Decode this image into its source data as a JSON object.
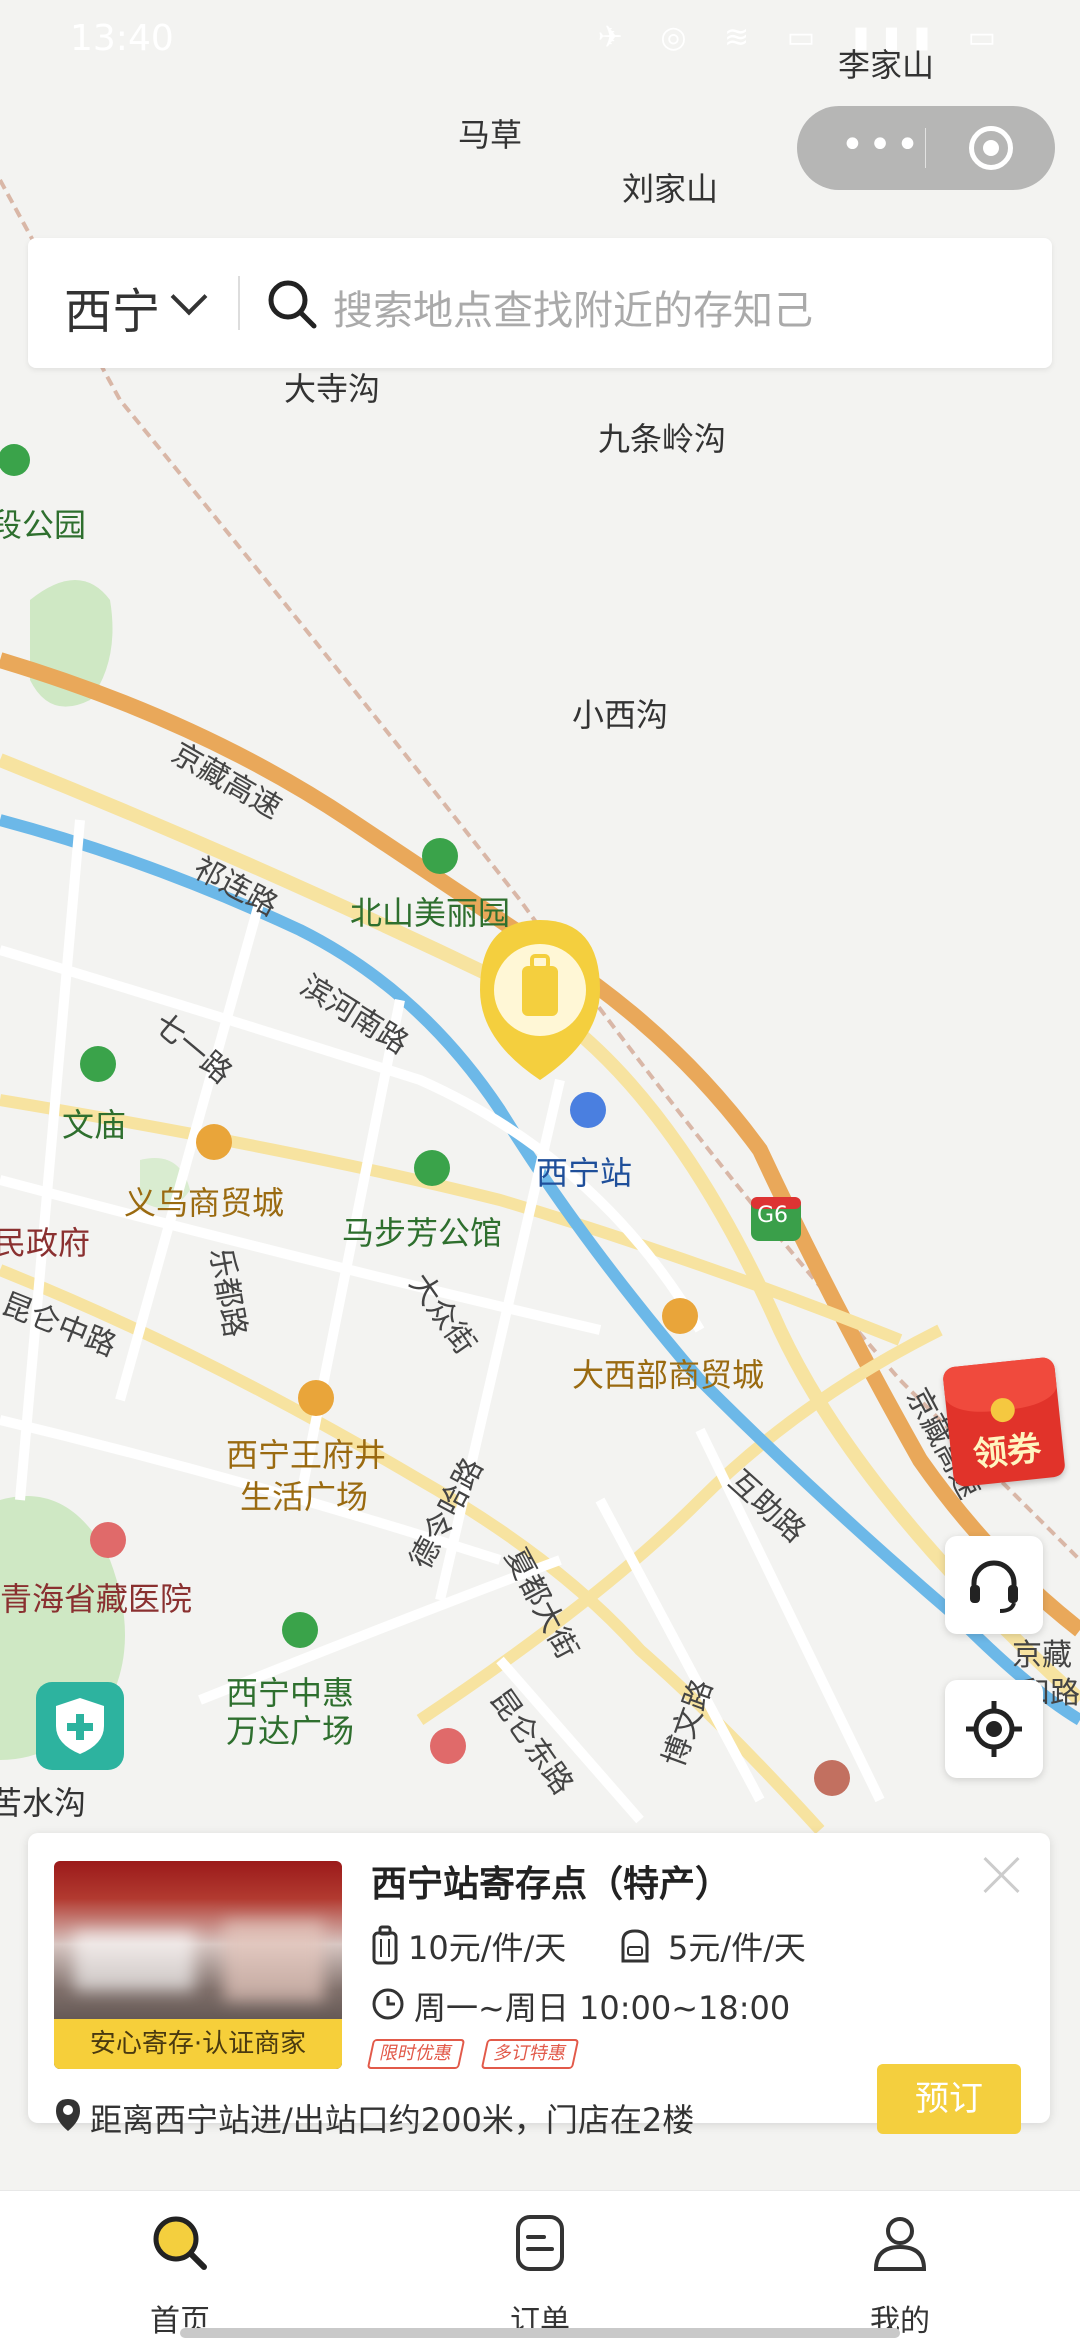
{
  "status_bar": {
    "time": "13:40",
    "icons": "✈ ◎ ≋ ▭ ▮▮▮ ▭"
  },
  "mini_program_capsule": {
    "more_icon": "more-dots-icon",
    "close_icon": "target-close-icon"
  },
  "search": {
    "city": "西宁",
    "placeholder": "搜索地点查找附近的存知己"
  },
  "map": {
    "labels": [
      {
        "text": "李家山",
        "style": "plain"
      },
      {
        "text": "马草",
        "style": "plain"
      },
      {
        "text": "刘家山",
        "style": "plain"
      },
      {
        "text": "大寺沟",
        "style": "plain"
      },
      {
        "text": "九条岭沟",
        "style": "plain"
      },
      {
        "text": "段公园",
        "style": "green"
      },
      {
        "text": "小西沟",
        "style": "plain"
      },
      {
        "text": "京藏高速",
        "style": "road"
      },
      {
        "text": "祁连路",
        "style": "road"
      },
      {
        "text": "北山美丽园",
        "style": "green"
      },
      {
        "text": "滨河南路",
        "style": "road"
      },
      {
        "text": "七一路",
        "style": "road"
      },
      {
        "text": "文庙",
        "style": "green"
      },
      {
        "text": "西宁站",
        "style": "blue"
      },
      {
        "text": "义乌商贸城",
        "style": "poi"
      },
      {
        "text": "马步芳公馆",
        "style": "green"
      },
      {
        "text": "民政府",
        "style": "red"
      },
      {
        "text": "乐都路",
        "style": "road"
      },
      {
        "text": "G6",
        "style": "shield"
      },
      {
        "text": "大众街",
        "style": "road"
      },
      {
        "text": "昆仑中路",
        "style": "road"
      },
      {
        "text": "大西部商贸城",
        "style": "poi"
      },
      {
        "text": "京藏高速",
        "style": "road"
      },
      {
        "text": "西宁王府井",
        "style": "poi"
      },
      {
        "text": "生活广场",
        "style": "poi"
      },
      {
        "text": "德令哈路",
        "style": "road"
      },
      {
        "text": "互助路",
        "style": "road"
      },
      {
        "text": "青海省藏医院",
        "style": "red"
      },
      {
        "text": "夏都大街",
        "style": "road"
      },
      {
        "text": "京藏",
        "style": "road"
      },
      {
        "text": "和路",
        "style": "road"
      },
      {
        "text": "西宁中惠",
        "style": "green"
      },
      {
        "text": "万达广场",
        "style": "green"
      },
      {
        "text": "昆仑东路",
        "style": "road"
      },
      {
        "text": "博文路",
        "style": "road"
      },
      {
        "text": "苦水沟",
        "style": "plain"
      }
    ]
  },
  "side_buttons": {
    "coupon_label": "领券",
    "service_icon": "headset-icon",
    "locate_icon": "locate-icon"
  },
  "store_card": {
    "title": "西宁站寄存点（特产）",
    "badge": "安心寄存·认证商家",
    "price_large": "10元/件/天",
    "price_small": "5元/件/天",
    "hours": "周一~周日 10:00~18:00",
    "tags": [
      "限时优惠",
      "多订特惠"
    ],
    "distance": "距离西宁站进/出站口约200米，门店在2楼",
    "book_label": "预订"
  },
  "tabbar": [
    {
      "label": "首页",
      "icon": "home-search-icon",
      "active": true
    },
    {
      "label": "订单",
      "icon": "order-icon",
      "active": false
    },
    {
      "label": "我的",
      "icon": "profile-icon",
      "active": false
    }
  ],
  "colors": {
    "accent": "#F4CF3E",
    "water": "#6CB8E8",
    "highway": "#E9A85A",
    "park": "#CFE8C4"
  }
}
